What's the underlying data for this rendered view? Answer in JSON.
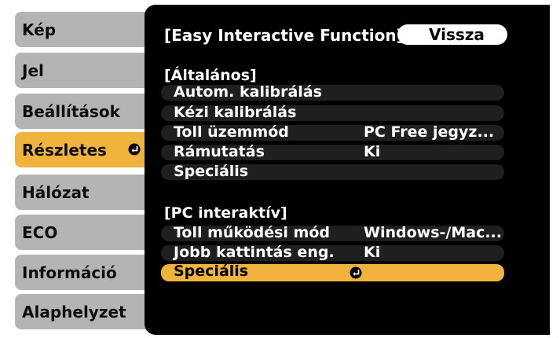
{
  "sidebar": {
    "items": [
      {
        "label": "Kép"
      },
      {
        "label": "Jel"
      },
      {
        "label": "Beállítások"
      },
      {
        "label": "Részletes"
      },
      {
        "label": "Hálózat"
      },
      {
        "label": "ECO"
      },
      {
        "label": "Információ"
      },
      {
        "label": "Alaphelyzet"
      }
    ],
    "selected_label": "Részletes"
  },
  "header": {
    "title": "[Easy Interactive Function]",
    "back_label": "Vissza"
  },
  "sections": {
    "general": {
      "heading": "[Általános]",
      "rows": [
        {
          "label": "Autom. kalibrálás",
          "value": ""
        },
        {
          "label": "Kézi kalibrálás",
          "value": ""
        },
        {
          "label": "Toll üzemmód",
          "value": "PC Free jegyz..."
        },
        {
          "label": "Rámutatás",
          "value": "Ki"
        },
        {
          "label": "Speciális",
          "value": ""
        }
      ]
    },
    "pc_interactive": {
      "heading": "[PC interaktív]",
      "rows": [
        {
          "label": "Toll működési mód",
          "value": "Windows-/Mac..."
        },
        {
          "label": "Jobb kattintás eng.",
          "value": "Ki"
        },
        {
          "label": "Speciális",
          "value": ""
        }
      ]
    }
  },
  "icons": {
    "enter": "enter-return-icon"
  },
  "colors": {
    "highlight": "#f0b43c",
    "tab": "#b4b4b4",
    "panel": "#000000"
  }
}
